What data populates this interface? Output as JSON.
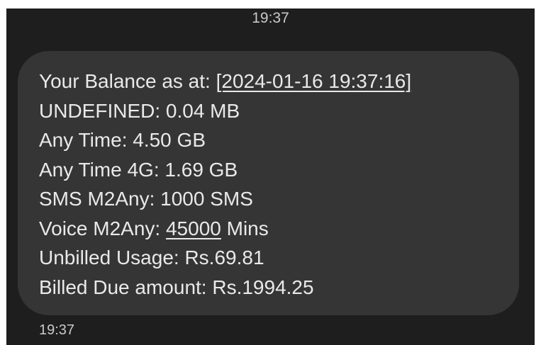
{
  "header": {
    "time": "19:37"
  },
  "message": {
    "balance_label": "Your Balance as at: ",
    "balance_datetime": "[2024-01-16 19:37:16]",
    "undefined": "UNDEFINED: 0.04 MB",
    "any_time": "Any Time: 4.50 GB",
    "any_time_4g": "Any Time 4G: 1.69 GB",
    "sms": "SMS M2Any: 1000 SMS",
    "voice_label": "Voice M2Any: ",
    "voice_minutes": "45000",
    "voice_unit": " Mins",
    "unbilled": "Unbilled Usage: Rs.69.81",
    "billed_due": "Billed Due amount: Rs.1994.25"
  },
  "footer": {
    "time": "19:37"
  },
  "colors": {
    "background": "#1e1e1e",
    "bubble": "#353535",
    "text": "#e9e9e9",
    "timestamp": "#c9c9c9"
  }
}
